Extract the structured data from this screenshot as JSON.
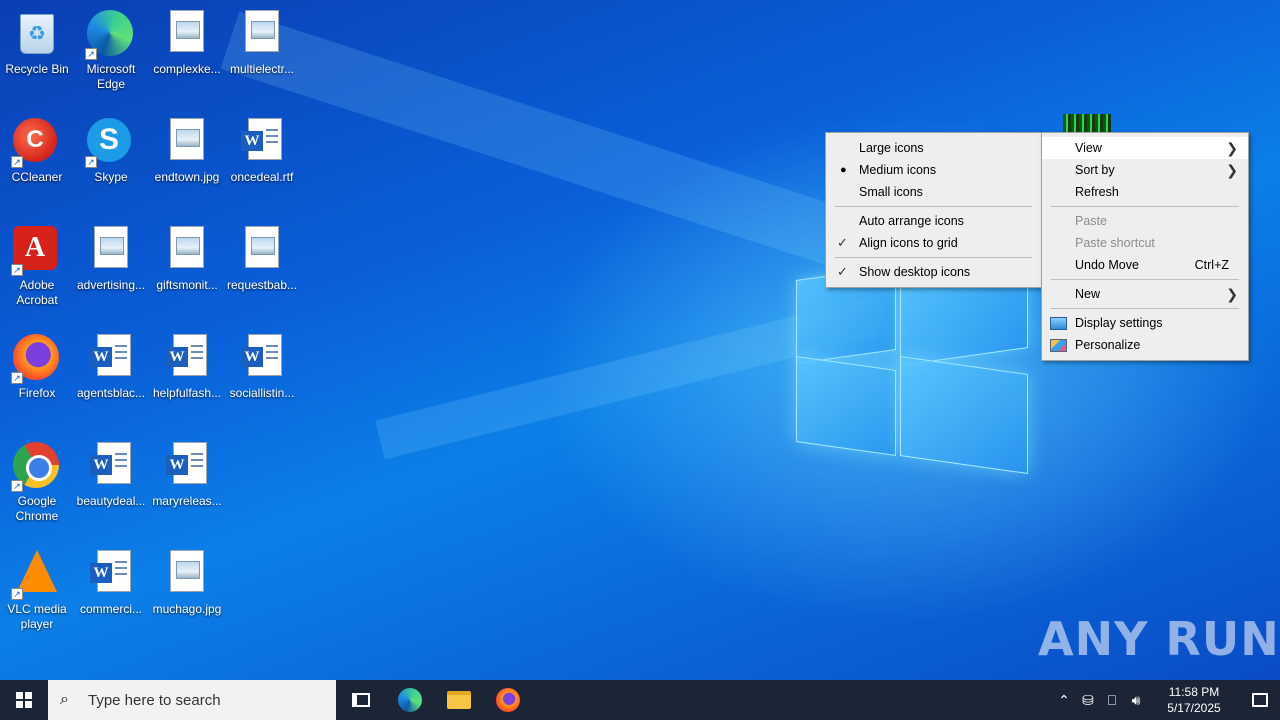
{
  "desktop": {
    "icons": [
      {
        "label": "Recycle Bin",
        "icon": "recycle-bin-icon"
      },
      {
        "label": "Microsoft Edge",
        "icon": "edge-icon"
      },
      {
        "label": "complexke...",
        "icon": "image-file-icon"
      },
      {
        "label": "multielectr...",
        "icon": "image-file-icon"
      },
      {
        "label": "CCleaner",
        "icon": "ccleaner-icon"
      },
      {
        "label": "Skype",
        "icon": "skype-icon"
      },
      {
        "label": "endtown.jpg",
        "icon": "image-file-icon"
      },
      {
        "label": "oncedeal.rtf",
        "icon": "word-doc-icon"
      },
      {
        "label": "Adobe Acrobat",
        "icon": "acrobat-icon"
      },
      {
        "label": "advertising...",
        "icon": "image-file-icon"
      },
      {
        "label": "giftsmonit...",
        "icon": "image-file-icon"
      },
      {
        "label": "requestbab...",
        "icon": "image-file-icon"
      },
      {
        "label": "Firefox",
        "icon": "firefox-icon"
      },
      {
        "label": "agentsblac...",
        "icon": "word-doc-icon"
      },
      {
        "label": "helpfulfash...",
        "icon": "word-doc-icon"
      },
      {
        "label": "sociallistin...",
        "icon": "word-doc-icon"
      },
      {
        "label": "Google Chrome",
        "icon": "chrome-icon"
      },
      {
        "label": "beautydeal...",
        "icon": "word-doc-icon"
      },
      {
        "label": "maryreleas...",
        "icon": "word-doc-icon"
      },
      {
        "label": "VLC media player",
        "icon": "vlc-icon"
      },
      {
        "label": "commerci...",
        "icon": "word-doc-icon"
      },
      {
        "label": "muchago.jpg",
        "icon": "image-file-icon"
      }
    ]
  },
  "context_menu": {
    "items": {
      "view": "View",
      "sort_by": "Sort by",
      "refresh": "Refresh",
      "paste": "Paste",
      "paste_shortcut": "Paste shortcut",
      "undo_move": "Undo Move",
      "undo_move_shortcut": "Ctrl+Z",
      "new": "New",
      "display_settings": "Display settings",
      "personalize": "Personalize"
    }
  },
  "view_submenu": {
    "items": {
      "large_icons": "Large icons",
      "medium_icons": "Medium icons",
      "small_icons": "Small icons",
      "auto_arrange": "Auto arrange icons",
      "align_to_grid": "Align icons to grid",
      "show_desktop_icons": "Show desktop icons"
    }
  },
  "watermark": "ANY RUN",
  "taskbar": {
    "search_placeholder": "Type here to search",
    "clock_time": "11:58 PM",
    "clock_date": "5/17/2025"
  }
}
